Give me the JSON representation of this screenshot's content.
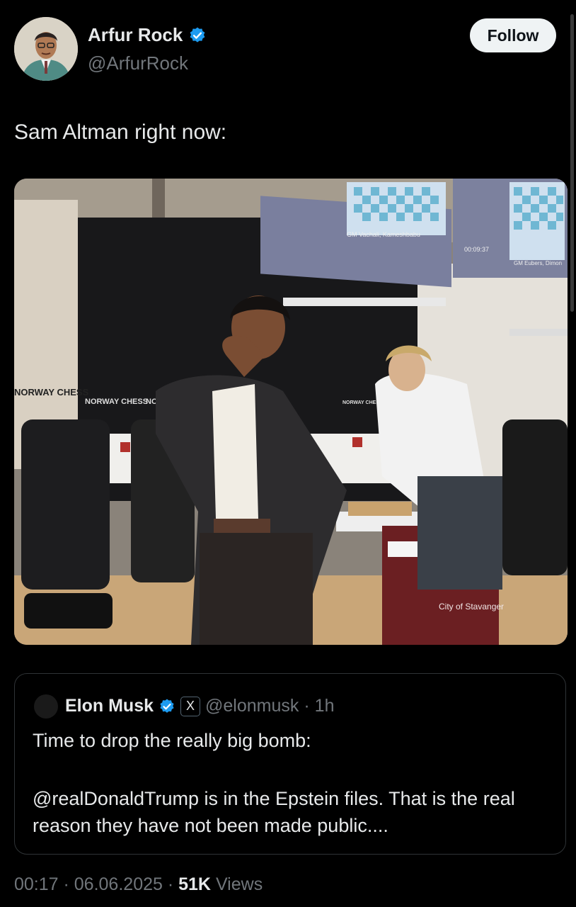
{
  "author": {
    "name": "Arfur Rock",
    "handle": "@ArfurRock",
    "verified": true
  },
  "follow_label": "Follow",
  "tweet_text": "Sam Altman right now:",
  "media": {
    "signs": [
      "NORWAY CHESS",
      "NORWAY CHESS",
      "NOR",
      "NORWAY CHESS"
    ],
    "screen_caption_left": "GM Vachali, Kameshbabu",
    "screen_caption_right": "GM Eubers, Dimon",
    "screen_timer": "00:09:37",
    "table_sign": "City of Stavanger"
  },
  "quote": {
    "name": "Elon Musk",
    "verified": true,
    "badge": "X",
    "handle": "@elonmusk",
    "time": "· 1h",
    "line1": "Time to drop the really big bomb:",
    "line2": "@realDonaldTrump is in the Epstein files. That is the real reason they have not been made public...."
  },
  "footer": {
    "time": "00:17 · 06.06.2025 ·",
    "views_count": "51K",
    "views_label": "Views"
  },
  "colors": {
    "background": "#000000",
    "text": "#e7e9ea",
    "secondary": "#71767b",
    "verified": "#1d9bf0",
    "border": "#2f3336"
  }
}
